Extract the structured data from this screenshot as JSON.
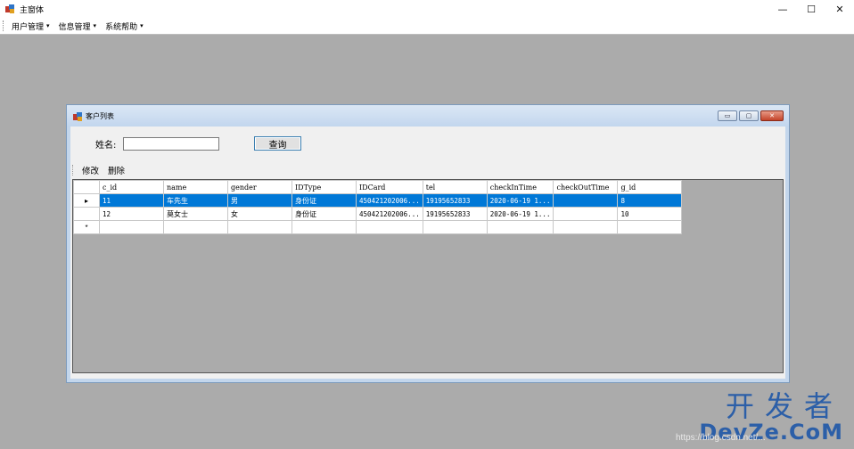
{
  "window": {
    "title": "主窗体",
    "controls": [
      "—",
      "☐",
      "✕"
    ]
  },
  "menubar": {
    "items": [
      {
        "label": "用户管理"
      },
      {
        "label": "信息管理"
      },
      {
        "label": "系统帮助"
      }
    ],
    "caret": "▾"
  },
  "child": {
    "title": "客户列表",
    "controls": [
      "▭",
      "▢",
      "✕"
    ],
    "search": {
      "label": "姓名:",
      "value": "",
      "placeholder": "",
      "button": "查询"
    },
    "toolbar": {
      "edit_label": "修改",
      "delete_label": "删除"
    },
    "grid": {
      "columns": [
        "c_id",
        "name",
        "gender",
        "IDType",
        "IDCard",
        "tel",
        "checkInTime",
        "checkOutTime",
        "g_id"
      ],
      "rows": [
        {
          "marker": "▸",
          "cells": [
            "11",
            "车先生",
            "男",
            "身份证",
            "450421202006...",
            "19195652833",
            "2020-06-19 1...",
            "",
            "8"
          ]
        },
        {
          "marker": "",
          "cells": [
            "12",
            "莫女士",
            "女",
            "身份证",
            "450421202006...",
            "19195652833",
            "2020-06-19 1...",
            "",
            "10"
          ]
        },
        {
          "marker": "*",
          "cells": [
            "",
            "",
            "",
            "",
            "",
            "",
            "",
            "",
            ""
          ]
        }
      ]
    }
  },
  "watermark": {
    "cn": "开发者",
    "en": "DevZe.CoM",
    "url": "https://blog.csdn.net/..."
  }
}
